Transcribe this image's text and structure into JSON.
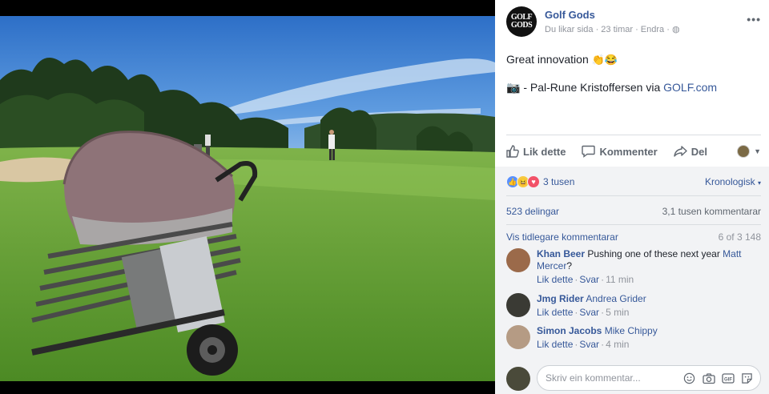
{
  "post": {
    "page_name": "Golf Gods",
    "avatar_text_line1": "GOLF",
    "avatar_text_line2": "GODS",
    "meta": "Du likar sida · 23 timar · Endra · ",
    "more": "•••",
    "text": "Great innovation ",
    "text_emojis": "👏😂",
    "credit_prefix": "📷 - Pal-Rune Kristoffersen via ",
    "credit_link": "GOLF.com"
  },
  "actions": {
    "like": "Lik dette",
    "comment": "Kommenter",
    "share": "Del"
  },
  "reactions": {
    "count": "3 tusen",
    "sort": "Kronologisk"
  },
  "stats": {
    "shares": "523 delingar",
    "comments": "3,1 tusen kommentarar"
  },
  "previous": {
    "label": "Vis tidlegare kommentarar",
    "count": "6 of 3 148"
  },
  "comments": [
    {
      "author": "Khan Beer",
      "text": " Pushing one of these next year ",
      "tag": "Matt Mercer",
      "after": "?",
      "like": "Lik dette",
      "reply": "Svar",
      "time": "11 min"
    },
    {
      "author": "Jmg Rider",
      "text": " ",
      "tag": "Andrea Grider",
      "after": "",
      "like": "Lik dette",
      "reply": "Svar",
      "time": "5 min"
    },
    {
      "author": "Simon Jacobs",
      "text": " ",
      "tag": "Mike Chippy",
      "after": "",
      "like": "Lik dette",
      "reply": "Svar",
      "time": "4 min"
    }
  ],
  "composer": {
    "placeholder": "Skriv ein kommentar..."
  },
  "colors": {
    "link": "#365899",
    "muted": "#90949c",
    "panel_bg": "#f2f3f5",
    "like_blue": "#5890ff",
    "love_red": "#f25268"
  }
}
